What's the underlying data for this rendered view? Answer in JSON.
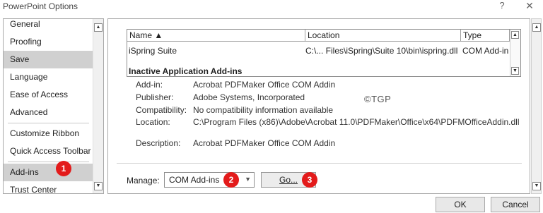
{
  "window": {
    "title": "PowerPoint Options",
    "help_label": "?",
    "close_label": "✕"
  },
  "sidebar": {
    "items": [
      {
        "label": "General"
      },
      {
        "label": "Proofing"
      },
      {
        "label": "Save"
      },
      {
        "label": "Language"
      },
      {
        "label": "Ease of Access"
      },
      {
        "label": "Advanced"
      },
      {
        "label": "Customize Ribbon"
      },
      {
        "label": "Quick Access Toolbar"
      },
      {
        "label": "Add-ins"
      },
      {
        "label": "Trust Center"
      }
    ],
    "up_arrow": "▲",
    "down_arrow": "▼"
  },
  "addins_table": {
    "columns": [
      "Name ▲",
      "Location",
      "Type"
    ],
    "rows": [
      {
        "name": "iSpring Suite",
        "location": "C:\\... Files\\iSpring\\Suite 10\\bin\\ispring.dll",
        "type": "COM Add-in"
      }
    ],
    "group_header": "Inactive Application Add-ins"
  },
  "details": {
    "addin_label": "Add-in:",
    "addin_value": "Acrobat PDFMaker Office COM Addin",
    "publisher_label": "Publisher:",
    "publisher_value": "Adobe Systems, Incorporated",
    "compat_label": "Compatibility:",
    "compat_value": "No compatibility information available",
    "location_label": "Location:",
    "location_value": "C:\\Program Files (x86)\\Adobe\\Acrobat 11.0\\PDFMaker\\Office\\x64\\PDFMOfficeAddin.dll",
    "description_label": "Description:",
    "description_value": "Acrobat PDFMaker Office COM Addin"
  },
  "watermark": "©TGP",
  "manage": {
    "label": "Manage:",
    "selected": "COM Add-ins",
    "dropdown_arrow": "▼",
    "go_label": "Go..."
  },
  "badges": [
    "1",
    "2",
    "3"
  ],
  "footer": {
    "ok_label": "OK",
    "cancel_label": "Cancel"
  },
  "colors": {
    "badge": "#e31b1b",
    "selected_nav": "#d0d0d0"
  }
}
